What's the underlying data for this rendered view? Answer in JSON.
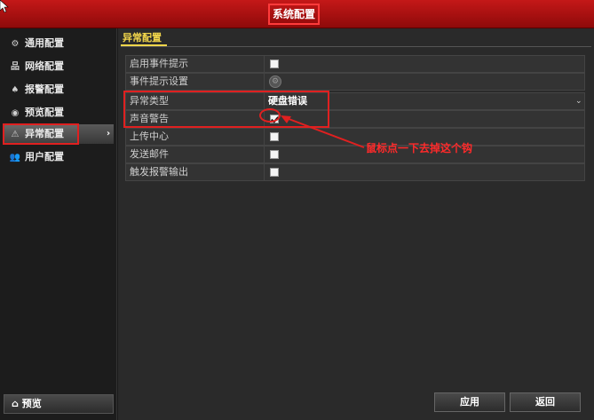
{
  "window": {
    "title": "系统配置"
  },
  "sidebar": {
    "items": [
      {
        "label": "通用配置",
        "icon": "gear-icon",
        "glyph": "⚙"
      },
      {
        "label": "网络配置",
        "icon": "network-icon",
        "glyph": "品"
      },
      {
        "label": "报警配置",
        "icon": "alarm-icon",
        "glyph": "♠"
      },
      {
        "label": "预览配置",
        "icon": "eye-icon",
        "glyph": "◉"
      },
      {
        "label": "异常配置",
        "icon": "warning-icon",
        "glyph": "⚠",
        "active": true
      },
      {
        "label": "用户配置",
        "icon": "users-icon",
        "glyph": "👥"
      }
    ],
    "preview_button": {
      "label": "预览",
      "icon": "home-icon",
      "glyph": "⌂"
    }
  },
  "main": {
    "section_title": "异常配置",
    "rows": [
      {
        "label": "启用事件提示",
        "control": "checkbox",
        "checked": false
      },
      {
        "label": "事件提示设置",
        "control": "gear"
      },
      {
        "label": "异常类型",
        "control": "dropdown",
        "value": "硬盘错误"
      },
      {
        "label": "声音警告",
        "control": "checkbox",
        "checked": true
      },
      {
        "label": "上传中心",
        "control": "checkbox",
        "checked": false
      },
      {
        "label": "发送邮件",
        "control": "checkbox",
        "checked": false
      },
      {
        "label": "触发报警输出",
        "control": "checkbox",
        "checked": false
      }
    ],
    "annotation": "鼠标点一下去掉这个钩"
  },
  "footer": {
    "apply_label": "应用",
    "back_label": "返回"
  },
  "colors": {
    "title_bar": "#c41818",
    "accent_red": "#e02020",
    "section_yellow": "#f2d64b"
  }
}
